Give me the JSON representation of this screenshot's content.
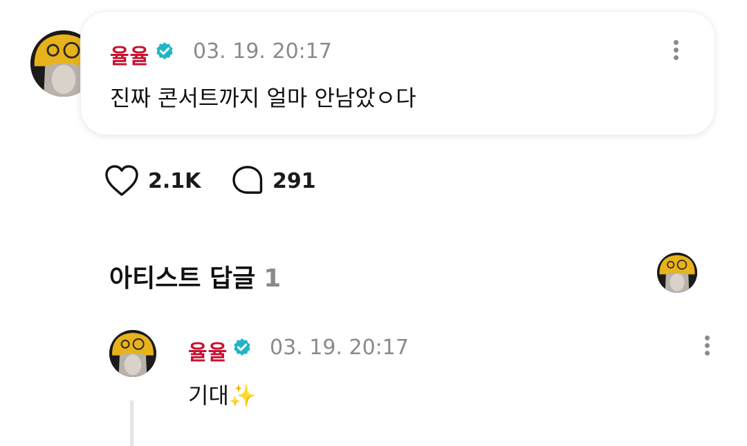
{
  "post": {
    "author": "율율",
    "timestamp": "03. 19. 20:17",
    "content": "진짜 콘서트까지 얼마 안남았ㅇ다",
    "likes": "2.1K",
    "comments": "291"
  },
  "replies_section": {
    "title": "아티스트 답글",
    "count": "1"
  },
  "reply": {
    "author": "율율",
    "timestamp": "03. 19. 20:17",
    "content": "기대✨"
  },
  "colors": {
    "author_name": "#c8102e",
    "verified_badge": "#1fb5c8",
    "timestamp": "#8a8a8a",
    "avatar_hat": "#e7b21b"
  },
  "icons": {
    "verified": "verified-badge-icon",
    "more": "more-vertical-icon",
    "like": "heart-icon",
    "comment": "comment-bubble-icon"
  }
}
